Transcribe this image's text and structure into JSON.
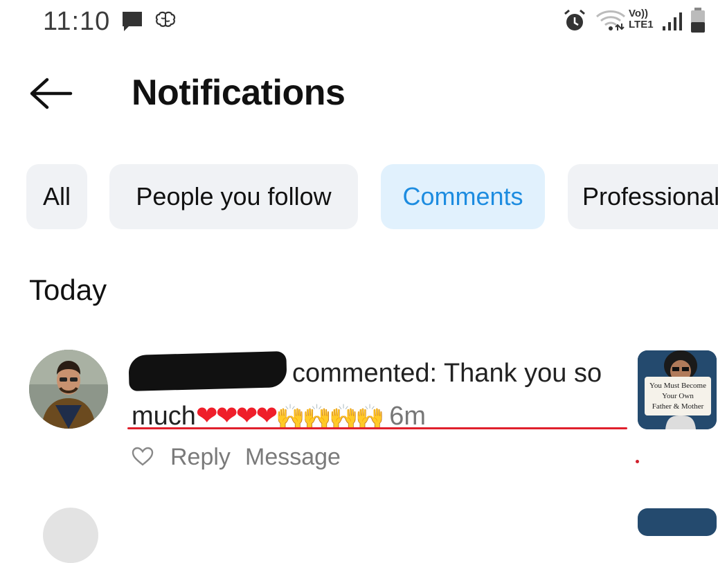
{
  "status_bar": {
    "time": "11:10",
    "network": "Vo))",
    "network_type": "LTE1",
    "icons": [
      "message-icon",
      "brain-icon",
      "alarm-icon",
      "wifi-icon",
      "signal-icon",
      "battery-icon"
    ]
  },
  "header": {
    "title": "Notifications",
    "back_icon": "arrow-left-icon"
  },
  "filters": {
    "chips": [
      {
        "label": "All",
        "active": false
      },
      {
        "label": "People you follow",
        "active": false
      },
      {
        "label": "Comments",
        "active": true
      },
      {
        "label": "Professional",
        "active": false
      }
    ]
  },
  "section": {
    "heading": "Today"
  },
  "notifications": [
    {
      "action_text": "commented: Thank you so",
      "comment_continuation": "much",
      "emoji_hearts": "❤❤❤❤",
      "emoji_hands": "🙌🙌🙌🙌",
      "time_ago": "6m",
      "actions": {
        "like_icon": "heart-outline-icon",
        "reply": "Reply",
        "message": "Message"
      },
      "thumbnail_text": [
        "You Must Become",
        "Your Own",
        "Father & Mother"
      ]
    }
  ],
  "colors": {
    "accent": "#1d8ce0",
    "active_chip_bg": "#e1f1fd",
    "chip_bg": "#f0f2f5",
    "underline": "#e0202c"
  }
}
